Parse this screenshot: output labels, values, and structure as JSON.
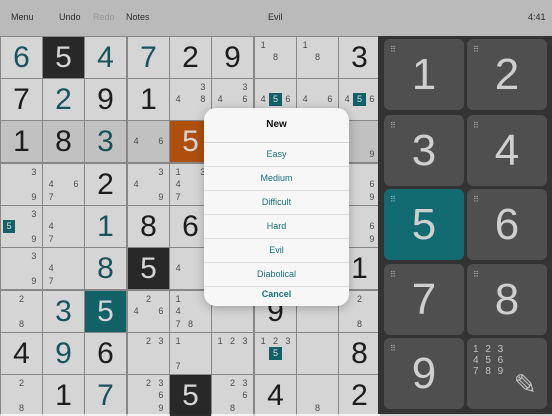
{
  "toolbar": {
    "menu_label": "Menu",
    "undo_label": "Undo",
    "redo_label": "Redo",
    "notes_label": "Notes",
    "title": "Evil",
    "time": "4:41"
  },
  "grid": {
    "rows": [
      [
        {
          "v": "6",
          "given": true
        },
        {
          "v": "5",
          "style": "dark"
        },
        {
          "v": "4",
          "given": true
        },
        {
          "v": "7",
          "given": true
        },
        {
          "v": "2"
        },
        {
          "v": "9"
        },
        {
          "n": [
            "1",
            "",
            "",
            "",
            "8",
            ""
          ]
        },
        {
          "n": [
            "1",
            "",
            "",
            "",
            "8",
            ""
          ]
        },
        {
          "v": "3"
        }
      ],
      [
        {
          "v": "7"
        },
        {
          "v": "2",
          "given": true
        },
        {
          "v": "9"
        },
        {
          "v": "1"
        },
        {
          "n": [
            "",
            "",
            "3",
            "4",
            "",
            "8"
          ]
        },
        {
          "n": [
            "",
            "",
            "3",
            "4",
            "",
            "6"
          ]
        },
        {
          "n": [
            "",
            "",
            "",
            "4",
            "5",
            "6"
          ]
        },
        {
          "n": [
            "",
            "",
            "",
            "4",
            "",
            "6"
          ]
        },
        {
          "n": [
            "",
            "",
            "",
            "4",
            "5",
            "6"
          ]
        }
      ],
      [
        {
          "v": "1"
        },
        {
          "v": "8"
        },
        {
          "v": "3",
          "given": true
        },
        {
          "n": [
            "",
            "",
            "",
            "4",
            "",
            "6"
          ]
        },
        {
          "v": "5",
          "style": "orange"
        },
        {
          "n": [
            "",
            "",
            ""
          ]
        },
        {
          "n": [
            "",
            "",
            ""
          ]
        },
        {
          "n": [
            "",
            "",
            ""
          ]
        },
        {
          "n": [
            "",
            "",
            "",
            "",
            "",
            "",
            "",
            "",
            "9"
          ]
        }
      ],
      [
        {
          "n": [
            "",
            "",
            "3",
            "",
            "",
            "",
            "",
            "",
            "9"
          ]
        },
        {
          "n": [
            "",
            "",
            "",
            "4",
            "",
            "6",
            "7"
          ]
        },
        {
          "v": "2"
        },
        {
          "n": [
            "",
            "",
            "3",
            "4",
            "",
            "",
            "",
            "",
            "9"
          ]
        },
        {
          "n": [
            "1",
            "",
            "3",
            "4",
            "",
            "",
            "7"
          ]
        },
        {
          "n": [
            "",
            "",
            ""
          ]
        },
        {
          "n": [
            "",
            "",
            ""
          ]
        },
        {
          "n": [
            "",
            "",
            ""
          ]
        },
        {
          "n": [
            "",
            "",
            "",
            "",
            "",
            "6",
            "",
            "",
            "9"
          ]
        }
      ],
      [
        {
          "n": [
            "",
            "",
            "3",
            "5",
            "",
            "",
            "",
            "",
            "9"
          ]
        },
        {
          "n": [
            "",
            "",
            "",
            "4",
            "",
            "",
            "7"
          ]
        },
        {
          "v": "1",
          "given": true
        },
        {
          "v": "8"
        },
        {
          "v": "6"
        },
        {
          "n": [
            "",
            "",
            ""
          ]
        },
        {
          "n": [
            "",
            "",
            ""
          ]
        },
        {
          "n": [
            "",
            "",
            ""
          ]
        },
        {
          "n": [
            "",
            "",
            "",
            "",
            "",
            "6",
            "",
            "",
            "9"
          ]
        }
      ],
      [
        {
          "n": [
            "",
            "",
            "3",
            "",
            "",
            "",
            "",
            "",
            "9"
          ]
        },
        {
          "n": [
            "",
            "",
            "",
            "4",
            "",
            "",
            "7"
          ]
        },
        {
          "v": "8",
          "given": true
        },
        {
          "v": "5",
          "style": "dark"
        },
        {
          "n": [
            "",
            "",
            "",
            "4"
          ]
        },
        {
          "n": [
            "",
            "",
            ""
          ]
        },
        {
          "n": [
            "",
            "",
            ""
          ]
        },
        {
          "n": [
            "",
            "",
            ""
          ]
        },
        {
          "v": "1"
        }
      ],
      [
        {
          "n": [
            "",
            "2",
            "",
            "",
            "",
            "",
            "",
            "8"
          ]
        },
        {
          "v": "3",
          "given": true
        },
        {
          "v": "5",
          "style": "teal"
        },
        {
          "n": [
            "",
            "2",
            "",
            "4",
            "",
            "6"
          ]
        },
        {
          "n": [
            "1",
            "",
            "",
            "4",
            "",
            "",
            "7",
            "8"
          ]
        },
        {
          "n": [
            "",
            "",
            ""
          ]
        },
        {
          "v": "9"
        },
        {
          "n": [
            "",
            "",
            ""
          ]
        },
        {
          "n": [
            "",
            "2",
            "",
            "",
            "",
            "",
            "",
            "8"
          ]
        }
      ],
      [
        {
          "v": "4"
        },
        {
          "v": "9",
          "given": true
        },
        {
          "v": "6"
        },
        {
          "n": [
            "",
            "2",
            "3"
          ]
        },
        {
          "n": [
            "1",
            "",
            "",
            "",
            "",
            "",
            "7"
          ]
        },
        {
          "n": [
            "1",
            "2",
            "3"
          ]
        },
        {
          "n": [
            "1",
            "2",
            "3",
            "",
            "5"
          ]
        },
        {
          "n": [
            "",
            "",
            ""
          ]
        },
        {
          "v": "8"
        }
      ],
      [
        {
          "n": [
            "",
            "2",
            "",
            "",
            "",
            "",
            "",
            "8"
          ]
        },
        {
          "v": "1"
        },
        {
          "v": "7",
          "given": true
        },
        {
          "n": [
            "",
            "2",
            "3",
            "",
            "",
            "6",
            "",
            "",
            "9"
          ]
        },
        {
          "v": "5",
          "style": "dark"
        },
        {
          "n": [
            "",
            "2",
            "3",
            "",
            "",
            "6",
            "",
            "8"
          ]
        },
        {
          "v": "4"
        },
        {
          "n": [
            "",
            "",
            "",
            "",
            "",
            "",
            "",
            "8"
          ]
        },
        {
          "v": "2"
        }
      ]
    ]
  },
  "keypad": {
    "keys": [
      {
        "label": "1",
        "style": "normal"
      },
      {
        "label": "2",
        "style": "normal"
      },
      {
        "label": "3",
        "style": "normal"
      },
      {
        "label": "4",
        "style": "normal"
      },
      {
        "label": "5",
        "style": "teal"
      },
      {
        "label": "6",
        "style": "normal"
      },
      {
        "label": "7",
        "style": "normal"
      },
      {
        "label": "8",
        "style": "normal"
      },
      {
        "label": "9",
        "style": "normal"
      }
    ],
    "notes_key": {
      "lines": [
        "1 2 3",
        "4 5 6",
        "7 8 9"
      ],
      "icon": "pencil-icon"
    }
  },
  "new_game_menu": {
    "title": "New",
    "items": [
      "Easy",
      "Medium",
      "Difficult",
      "Hard",
      "Evil",
      "Diabolical"
    ],
    "cancel_label": "Cancel"
  },
  "colors": {
    "teal": "#156f76",
    "orange": "#c65a10",
    "dark_cell": "#2e2e2e",
    "keypad_bg": "#3b3b3b",
    "menu_text": "#17707a"
  }
}
